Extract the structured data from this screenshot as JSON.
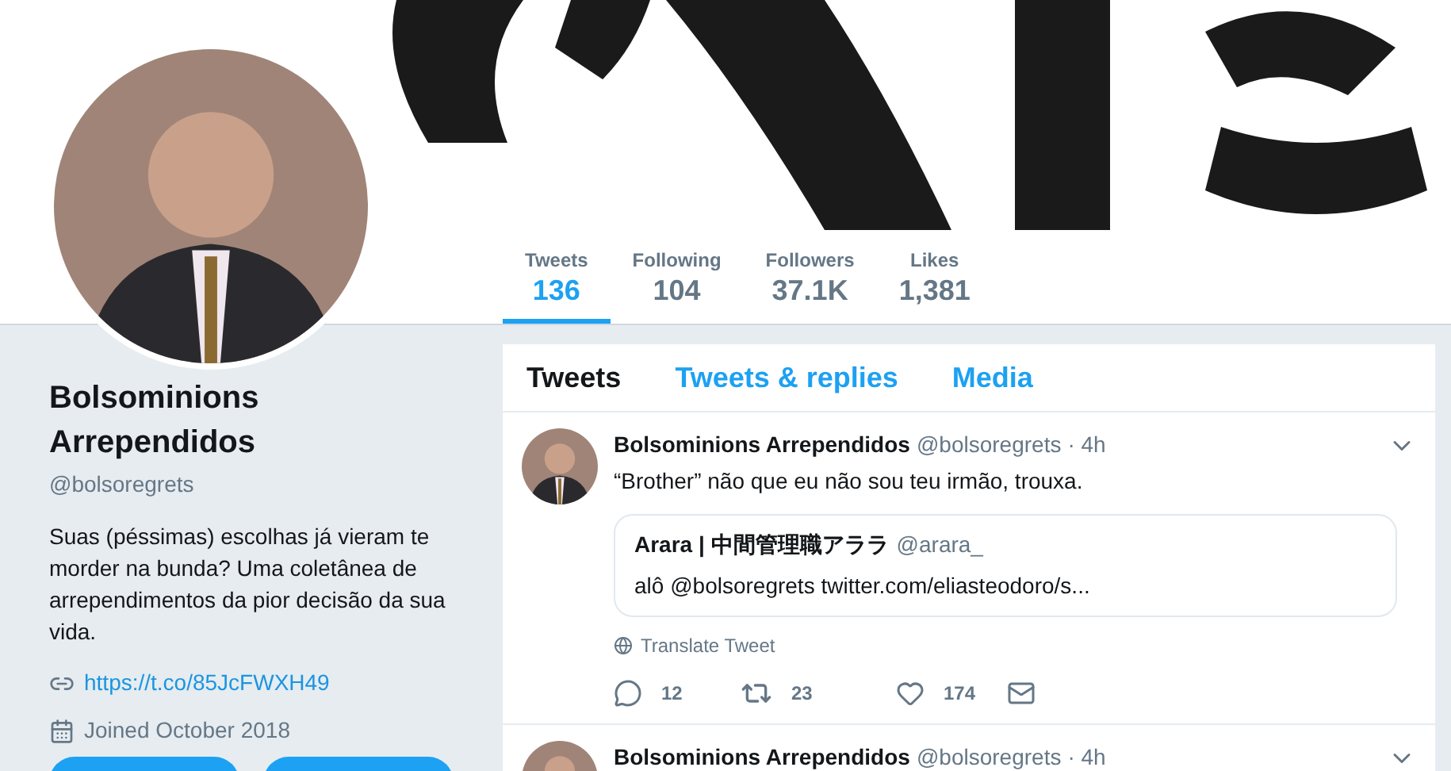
{
  "profile": {
    "name": "Bolsominions Arrependidos",
    "handle": "@bolsoregrets",
    "bio": "Suas (péssimas) escolhas já vieram te morder na bunda? Uma coletânea de arrependimentos da pior decisão da sua vida.",
    "link": "https://t.co/85JcFWXH49",
    "joined": "Joined October 2018"
  },
  "stats": [
    {
      "label": "Tweets",
      "value": "136",
      "selected": true
    },
    {
      "label": "Following",
      "value": "104",
      "selected": false
    },
    {
      "label": "Followers",
      "value": "37.1K",
      "selected": false
    },
    {
      "label": "Likes",
      "value": "1,381",
      "selected": false
    }
  ],
  "tabs": [
    {
      "label": "Tweets",
      "selected": true
    },
    {
      "label": "Tweets & replies",
      "selected": false
    },
    {
      "label": "Media",
      "selected": false
    }
  ],
  "tweets": [
    {
      "name": "Bolsominions Arrependidos",
      "handle": "@bolsoregrets",
      "time": "· 4h",
      "text": "“Brother” não que eu não sou teu irmão, trouxa.",
      "quote": {
        "name": "Arara | 中間管理職アララ",
        "handle": "@arara_",
        "text": "alô @bolsoregrets twitter.com/eliasteodoro/s..."
      },
      "translate": "Translate Tweet",
      "replies": "12",
      "retweets": "23",
      "likes": "174"
    },
    {
      "name": "Bolsominions Arrependidos",
      "handle": "@bolsoregrets",
      "time": "· 4h"
    }
  ]
}
